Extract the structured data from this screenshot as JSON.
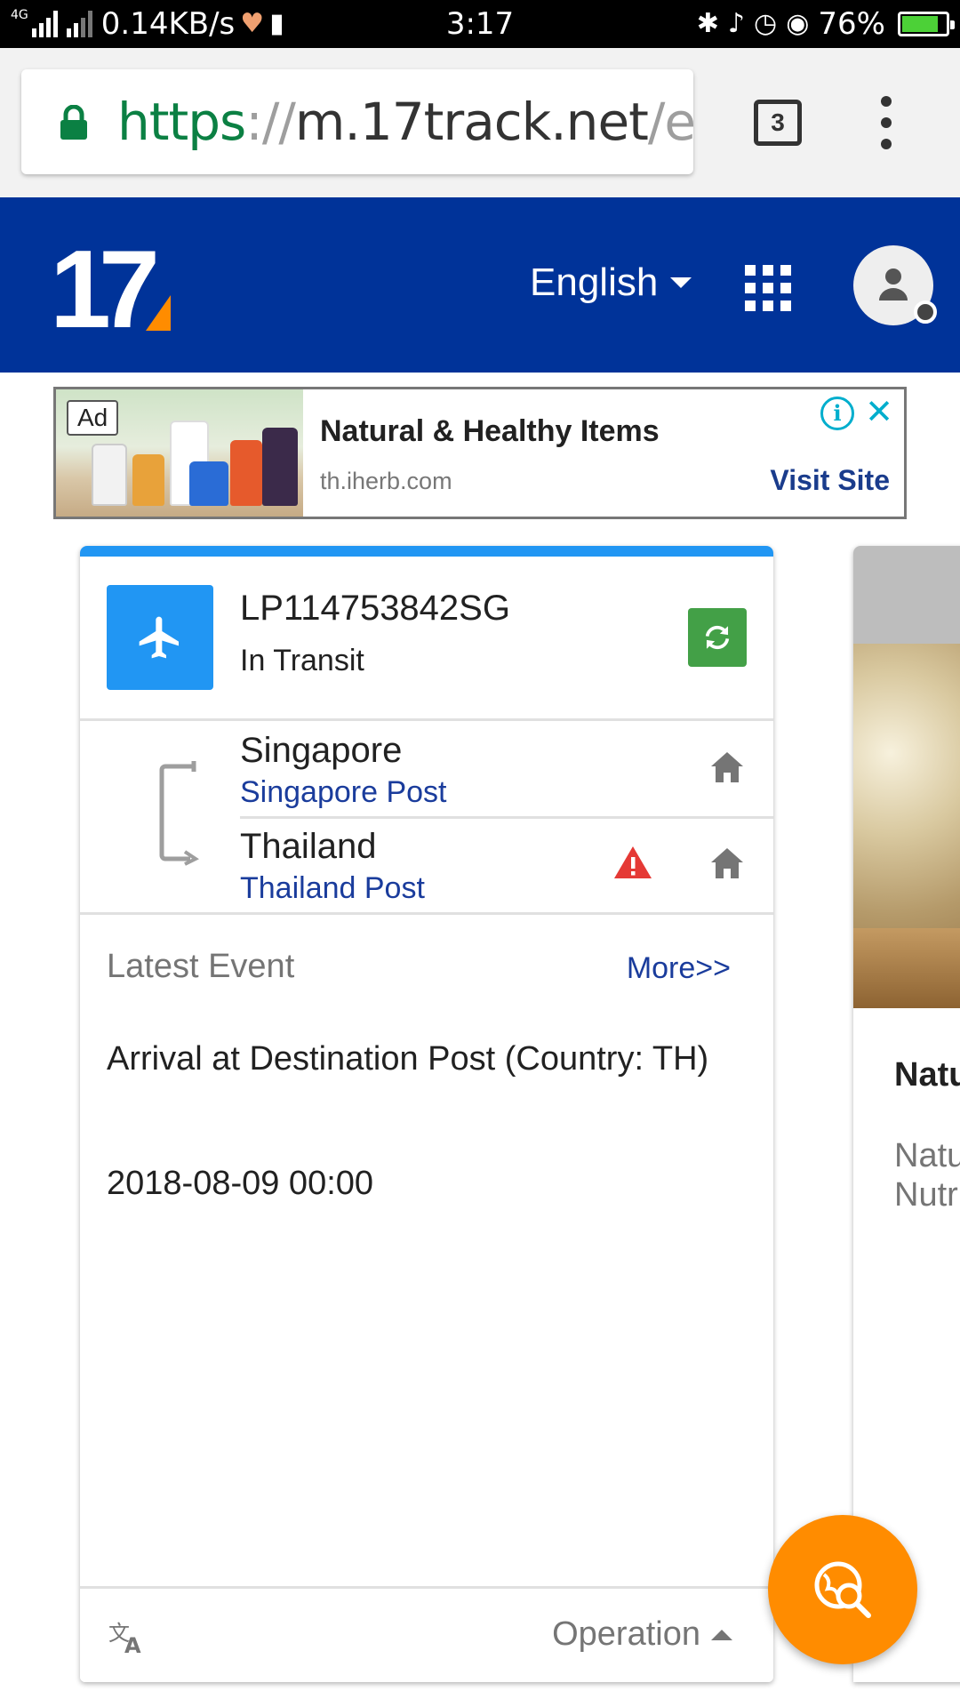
{
  "status_bar": {
    "network_type": "4G",
    "data_speed": "0.14KB/s",
    "time": "3:17",
    "battery": "76%",
    "battery_level": 0.76,
    "icons": [
      "signal-icon",
      "signal-icon",
      "health-icon",
      "sim-icon",
      "bluetooth-icon",
      "mute-icon",
      "alarm-icon",
      "eye-icon",
      "battery-icon"
    ]
  },
  "browser": {
    "url_scheme": "https",
    "url_separator": "://",
    "url_host": "m.17track.net",
    "url_path": "/en",
    "tab_count": "3",
    "icons": [
      "lock-icon",
      "tabs-icon",
      "overflow-menu-icon"
    ]
  },
  "header": {
    "logo_text": "17",
    "language": "English",
    "colors": {
      "header_bg": "#003399",
      "logo_accent": "#ff8c00"
    },
    "icons": [
      "apps-grid-icon",
      "avatar-icon"
    ]
  },
  "ad": {
    "badge": "Ad",
    "title": "Natural & Healthy Items",
    "domain": "th.iherb.com",
    "cta": "Visit Site",
    "icons": [
      "info-icon",
      "close-icon"
    ]
  },
  "tracking": {
    "number": "LP114753842SG",
    "status": "In Transit",
    "origin": {
      "country": "Singapore",
      "carrier": "Singapore Post"
    },
    "destination": {
      "country": "Thailand",
      "carrier": "Thailand Post"
    },
    "latest_event_label": "Latest Event",
    "more_link": "More>>",
    "event_description": "Arrival at Destination Post (Country: TH)",
    "event_time": "2018-08-09 00:00",
    "operation_label": "Operation",
    "colors": {
      "accent": "#2196f3",
      "refresh": "#43a047",
      "link": "#1a3c9c",
      "warning": "#e53935"
    },
    "icons": [
      "airplane-icon",
      "refresh-icon",
      "home-icon",
      "warning-icon",
      "translate-icon"
    ]
  },
  "side_card": {
    "title": "Natu",
    "desc_line1": "Natu",
    "desc_line2": "Nutr"
  },
  "fab": {
    "color": "#ff8c00",
    "icon": "global-search-icon"
  }
}
